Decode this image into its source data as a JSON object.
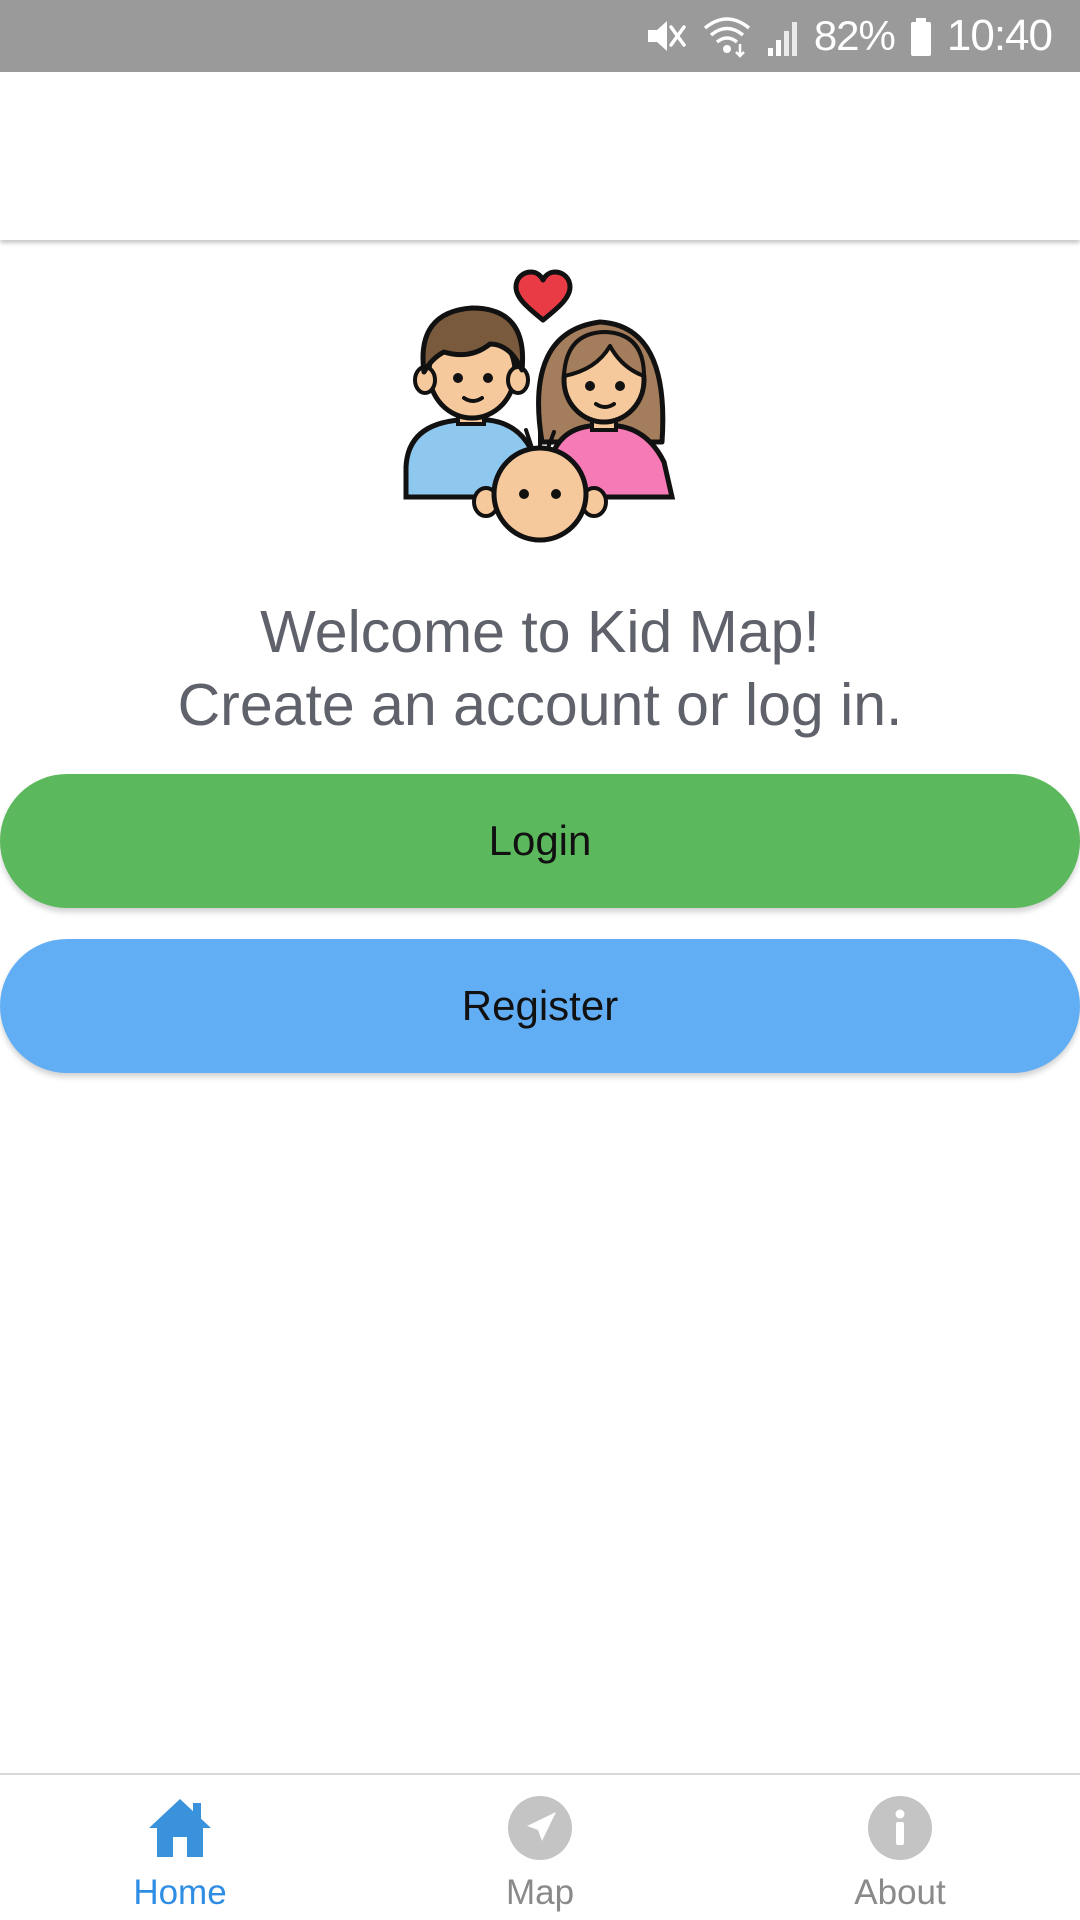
{
  "status_bar": {
    "battery_percent": "82%",
    "time": "10:40",
    "icons": [
      "vibrate-mute-icon",
      "wifi-icon",
      "cell-signal-icon",
      "battery-icon"
    ]
  },
  "welcome": {
    "line1": "Welcome to Kid Map!",
    "line2": "Create an account or log in."
  },
  "buttons": {
    "login_label": "Login",
    "register_label": "Register"
  },
  "tabs": [
    {
      "label": "Home",
      "icon": "home-icon",
      "active": true
    },
    {
      "label": "Map",
      "icon": "navigation-arrow-icon",
      "active": false
    },
    {
      "label": "About",
      "icon": "info-icon",
      "active": false
    }
  ],
  "colors": {
    "status_bar": "#9a9a9a",
    "login_button": "#5cb85c",
    "register_button": "#62aef5",
    "active_tab": "#2f8de4",
    "inactive_tab": "#8a8a8a",
    "welcome_text": "#5f616b"
  }
}
